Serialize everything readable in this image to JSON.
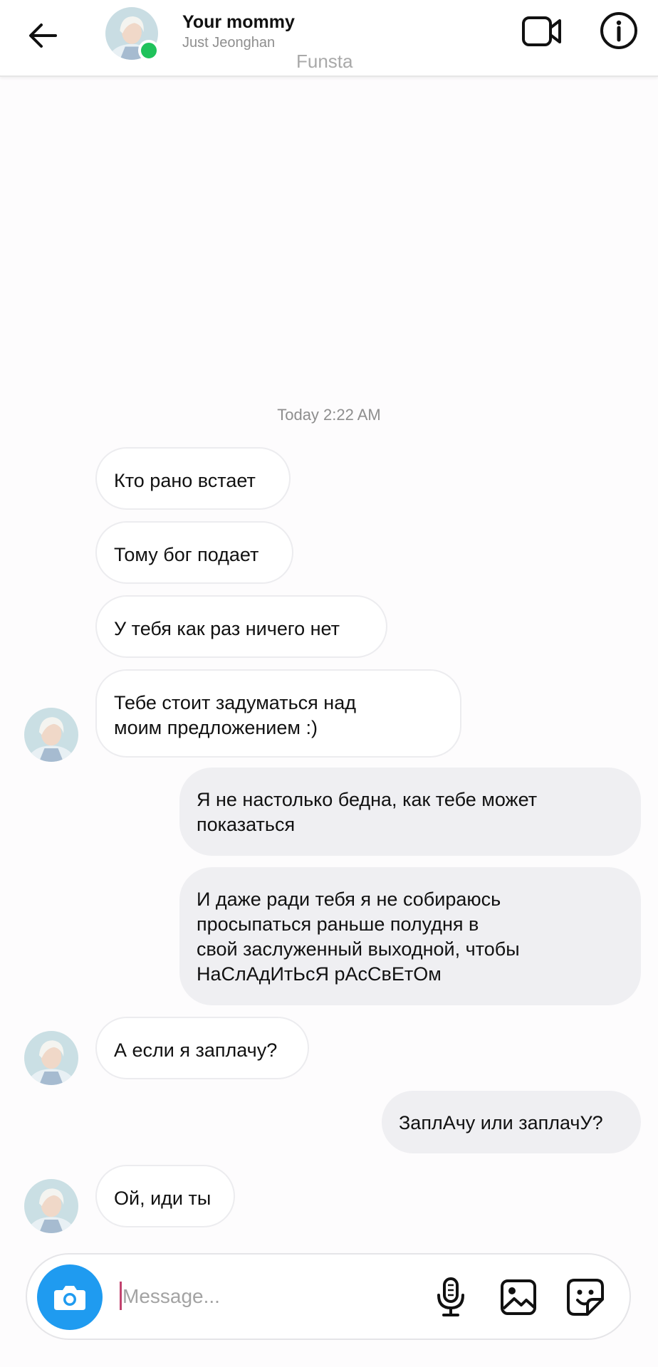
{
  "header": {
    "title": "Your mommy",
    "subtitle": "Just Jeonghan",
    "overlay_label": "Funsta",
    "online_status_color": "#1fc25b"
  },
  "icons": {
    "back": "arrow-left-icon",
    "video": "video-camera-icon",
    "info": "info-icon",
    "camera": "camera-icon",
    "mic": "microphone-icon",
    "gallery": "gallery-icon",
    "sticker": "sticker-icon"
  },
  "conversation": {
    "timestamp": "Today 2:22 AM",
    "messages": [
      {
        "from": "them",
        "text": "Кто рано встает"
      },
      {
        "from": "them",
        "text": "Тому бог подает"
      },
      {
        "from": "them",
        "text": "У тебя как раз ничего нет"
      },
      {
        "from": "them",
        "lines": [
          "Тебе стоит задуматься над",
          "моим предложением :)"
        ]
      },
      {
        "from": "me",
        "lines": [
          "Я не настолько бедна, как тебе может",
          "показаться"
        ]
      },
      {
        "from": "me",
        "lines": [
          "И даже ради тебя я не собираюсь",
          "просыпаться раньше полудня в",
          "свой заслуженный выходной, чтобы",
          "НаСлАдИтЬсЯ рАсСвЕтОм"
        ]
      },
      {
        "from": "them",
        "text": "А если я заплачу?"
      },
      {
        "from": "me",
        "text": "ЗаплАчу или заплачУ?"
      },
      {
        "from": "them",
        "text": "Ой, иди ты"
      }
    ]
  },
  "composer": {
    "placeholder": "Message...",
    "value": "",
    "camera_color": "#1f9bf0",
    "caret_color": "#c2436f"
  },
  "colors": {
    "incoming_bubble": "#ffffff",
    "outgoing_bubble": "#efeff2",
    "timestamp": "#8e8e8e"
  }
}
